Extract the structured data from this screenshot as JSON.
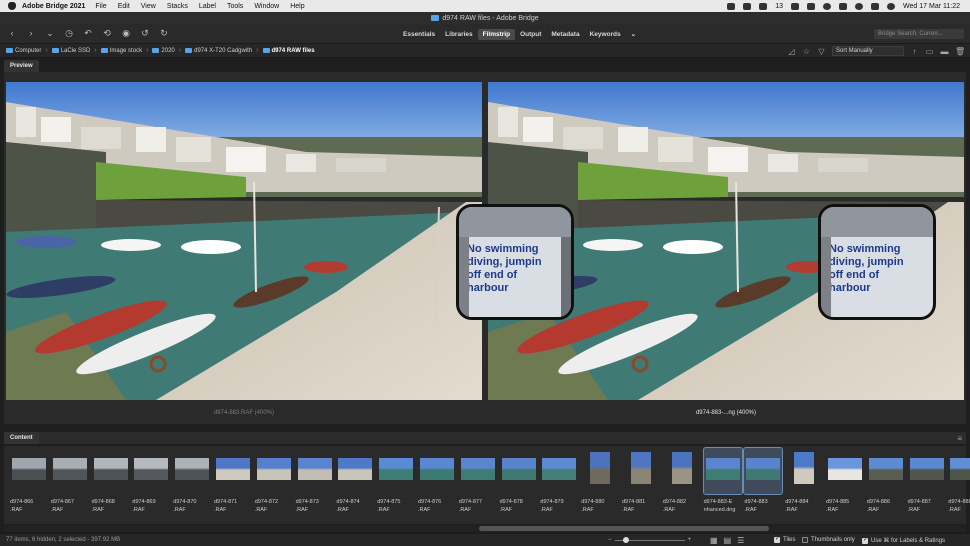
{
  "menubar": {
    "app": "Adobe Bridge 2021",
    "items": [
      "File",
      "Edit",
      "View",
      "Stacks",
      "Label",
      "Tools",
      "Window",
      "Help"
    ],
    "status_count": "13",
    "datetime": "Wed 17 Mar  11:22"
  },
  "window": {
    "title": "d974 RAW files - Adobe Bridge"
  },
  "toolbar": {
    "workspaces": [
      "Essentials",
      "Libraries",
      "Filmstrip",
      "Output",
      "Metadata",
      "Keywords"
    ],
    "active_workspace": "Filmstrip",
    "more": "⌄",
    "search_placeholder": "Bridge Search: Curren..."
  },
  "path": {
    "crumbs": [
      "Computer",
      "LaCie SSD",
      "Image stock",
      "2020",
      "d974 X-T20 Cadgwith",
      "d974 RAW files"
    ],
    "sort": "Sort Manually"
  },
  "preview": {
    "tab": "Preview",
    "left_caption": "d974-883.RAF (400%)",
    "right_caption": "d974-883-...ng (400%)",
    "loupe_lines": [
      "No swimming",
      "diving, jumpin",
      "off end of",
      "harbour"
    ]
  },
  "content": {
    "tab": "Content",
    "thumbs": [
      {
        "name": "d974-866",
        "ext": ".RAF"
      },
      {
        "name": "d974-867",
        "ext": ".RAF"
      },
      {
        "name": "d974-868",
        "ext": ".RAF"
      },
      {
        "name": "d974-869",
        "ext": ".RAF"
      },
      {
        "name": "d974-870",
        "ext": ".RAF"
      },
      {
        "name": "d974-871",
        "ext": ".RAF"
      },
      {
        "name": "d974-872",
        "ext": ".RAF"
      },
      {
        "name": "d974-873",
        "ext": ".RAF"
      },
      {
        "name": "d974-874",
        "ext": ".RAF"
      },
      {
        "name": "d974-875",
        "ext": ".RAF"
      },
      {
        "name": "d974-876",
        "ext": ".RAF"
      },
      {
        "name": "d974-877",
        "ext": ".RAF"
      },
      {
        "name": "d974-878",
        "ext": ".RAF"
      },
      {
        "name": "d974-879",
        "ext": ".RAF"
      },
      {
        "name": "d974-880",
        "ext": ".RAF"
      },
      {
        "name": "d974-881",
        "ext": ".RAF"
      },
      {
        "name": "d974-882",
        "ext": ".RAF"
      },
      {
        "name": "d974-883-E",
        "ext": "nhanced.dng"
      },
      {
        "name": "d974-883",
        "ext": ".RAF"
      },
      {
        "name": "d974-884",
        "ext": ".RAF"
      },
      {
        "name": "d974-885",
        "ext": ".RAF"
      },
      {
        "name": "d974-886",
        "ext": ".RAF"
      },
      {
        "name": "d974-887",
        "ext": ".RAF"
      },
      {
        "name": "d974-888",
        "ext": ".RAF"
      }
    ]
  },
  "status": {
    "summary": "77 items, 6 hidden, 2 selected - 397.92 MB",
    "tiles": "Tiles",
    "thumbnails_only": "Thumbnails only",
    "use_cmd": "Use ⌘ for Labels & Ratings"
  }
}
